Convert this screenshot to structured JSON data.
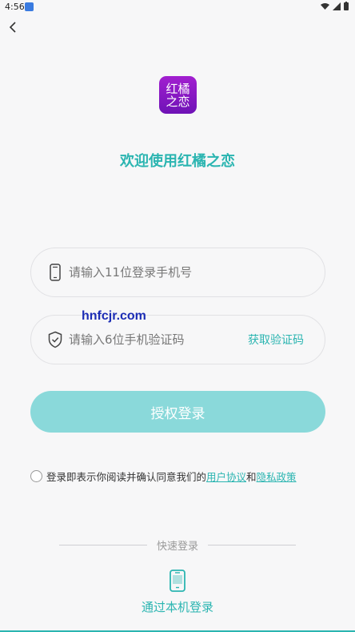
{
  "status_bar": {
    "time": "4:56"
  },
  "logo": {
    "line1": "红橘",
    "line2": "之恋",
    "colors": [
      "#a21fd0",
      "#6e12b6"
    ]
  },
  "welcome": "欢迎使用红橘之恋",
  "phone_field": {
    "placeholder": "请输入11位登录手机号",
    "value": "",
    "icon": "phone-icon"
  },
  "code_field": {
    "placeholder": "请输入6位手机验证码",
    "value": "",
    "icon": "shield-icon",
    "get_code_label": "获取验证码"
  },
  "watermark": "hnfcjr.com",
  "login_button": "授权登录",
  "agreement": {
    "prefix": "登录即表示你阅读并确认同意我们的",
    "user_agreement": "用户协议",
    "and": "和",
    "privacy_policy": "隐私政策"
  },
  "quick_login": {
    "label": "快速登录",
    "local_login_label": "通过本机登录",
    "icon": "phone-icon"
  },
  "colors": {
    "accent": "#2bb5b1",
    "button_bg": "#8ad9da",
    "background": "#f7f7f8"
  }
}
